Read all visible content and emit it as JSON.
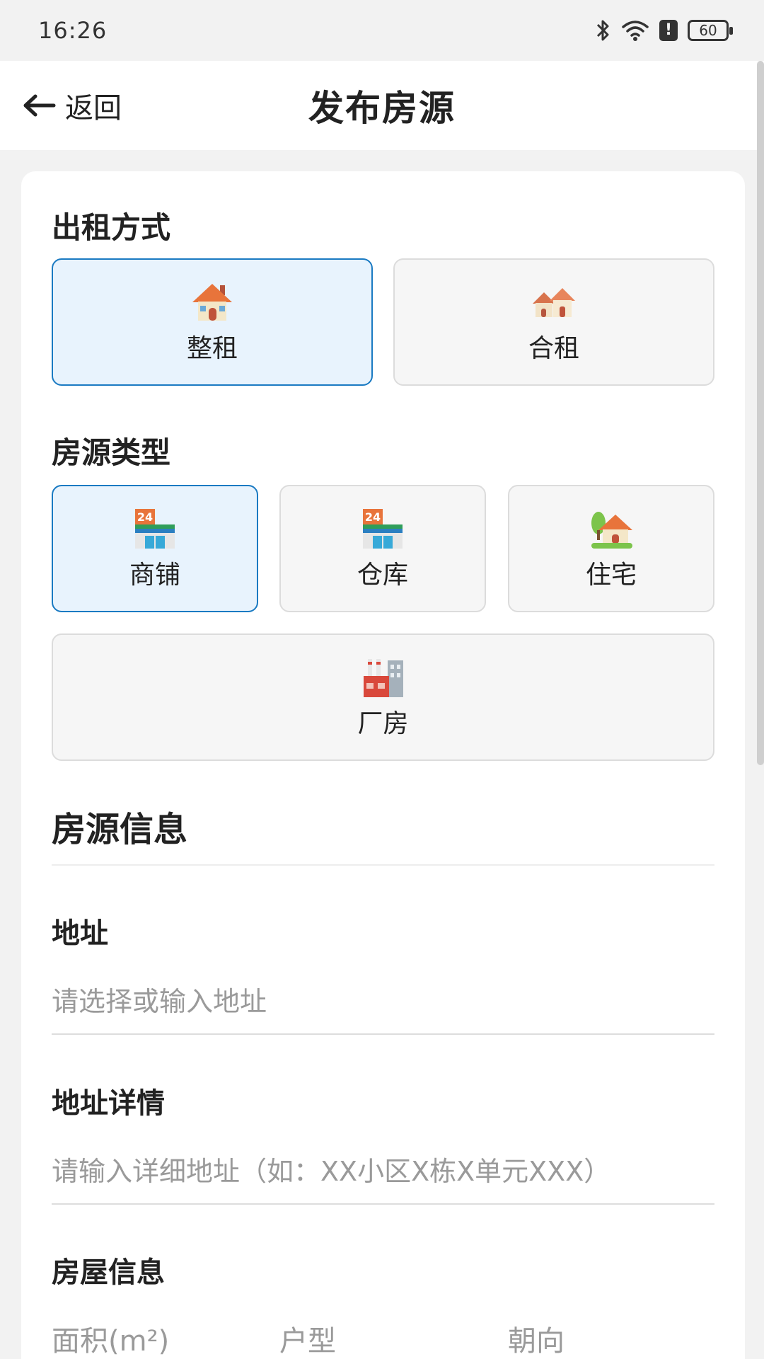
{
  "status_bar": {
    "time": "16:26",
    "battery": "60"
  },
  "nav": {
    "back_label": "返回",
    "title": "发布房源"
  },
  "rental_mode": {
    "title": "出租方式",
    "options": [
      {
        "label": "整租",
        "icon": "house-icon",
        "selected": true
      },
      {
        "label": "合租",
        "icon": "houses-icon",
        "selected": false
      }
    ]
  },
  "property_type": {
    "title": "房源类型",
    "options": [
      {
        "label": "商铺",
        "icon": "convenience-store-icon",
        "selected": true
      },
      {
        "label": "仓库",
        "icon": "convenience-store-icon",
        "selected": false
      },
      {
        "label": "住宅",
        "icon": "house-with-garden-icon",
        "selected": false
      },
      {
        "label": "厂房",
        "icon": "factory-icon",
        "selected": false
      }
    ]
  },
  "info": {
    "title": "房源信息",
    "address": {
      "label": "地址",
      "placeholder": "请选择或输入地址"
    },
    "address_detail": {
      "label": "地址详情",
      "placeholder": "请输入详细地址（如：XX小区X栋X单元XXX）"
    },
    "house_info": {
      "label": "房屋信息",
      "columns": [
        "面积(m²)",
        "户型",
        "朝向"
      ]
    }
  },
  "colors": {
    "accent": "#1a7ac2",
    "selected_bg": "#e8f3fd"
  }
}
